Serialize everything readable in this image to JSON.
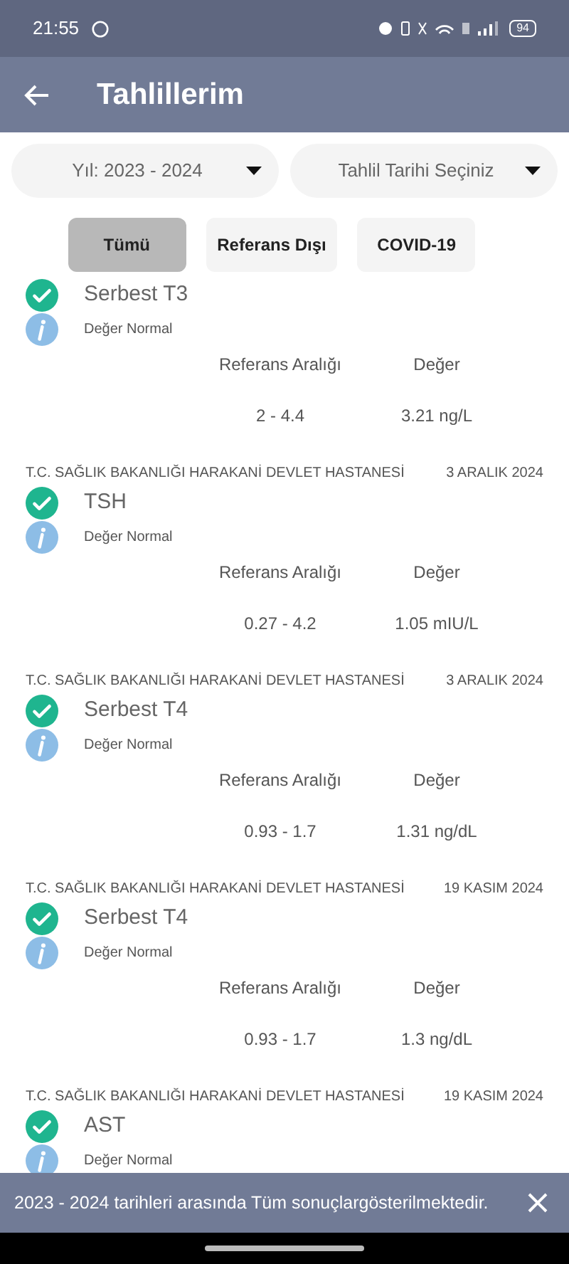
{
  "status_bar": {
    "time": "21:55",
    "battery": "94"
  },
  "header": {
    "title": "Tahlillerim"
  },
  "filters": [
    {
      "label": "Yıl: 2023 - 2024"
    },
    {
      "label": "Tahlil Tarihi Seçiniz"
    }
  ],
  "tabs": [
    {
      "label": "Tümü",
      "selected": true
    },
    {
      "label": "Referans Dışı",
      "selected": false
    },
    {
      "label": "COVID-19",
      "selected": false
    }
  ],
  "results": [
    {
      "name": "Serbest T3",
      "status": "Değer Normal",
      "normal": true,
      "range_label": "Referans Aralığı",
      "value_label": "Değer",
      "range": "2 - 4.4",
      "value": "3.21 ng/L"
    },
    {
      "hospital": "T.C. SAĞLIK BAKANLIĞI HARAKANİ DEVLET HASTANESİ",
      "date": "3 ARALIK 2024",
      "name": "TSH",
      "status": "Değer Normal",
      "normal": true,
      "range_label": "Referans Aralığı",
      "value_label": "Değer",
      "range": "0.27 - 4.2",
      "value": "1.05 mIU/L"
    },
    {
      "hospital": "T.C. SAĞLIK BAKANLIĞI HARAKANİ DEVLET HASTANESİ",
      "date": "3 ARALIK 2024",
      "name": "Serbest T4",
      "status": "Değer Normal",
      "normal": true,
      "range_label": "Referans Aralığı",
      "value_label": "Değer",
      "range": "0.93 - 1.7",
      "value": "1.31 ng/dL"
    },
    {
      "hospital": "T.C. SAĞLIK BAKANLIĞI HARAKANİ DEVLET HASTANESİ",
      "date": "19 KASIM 2024",
      "name": "Serbest T4",
      "status": "Değer Normal",
      "normal": true,
      "range_label": "Referans Aralığı",
      "value_label": "Değer",
      "range": "0.93 - 1.7",
      "value": "1.3 ng/dL"
    },
    {
      "hospital": "T.C. SAĞLIK BAKANLIĞI HARAKANİ DEVLET HASTANESİ",
      "date": "19 KASIM 2024",
      "name": "AST",
      "status": "Değer Normal",
      "normal": true
    }
  ],
  "snackbar": {
    "message": "2023 - 2024 tarihleri arasında Tüm sonuçlargösterilmektedir."
  }
}
